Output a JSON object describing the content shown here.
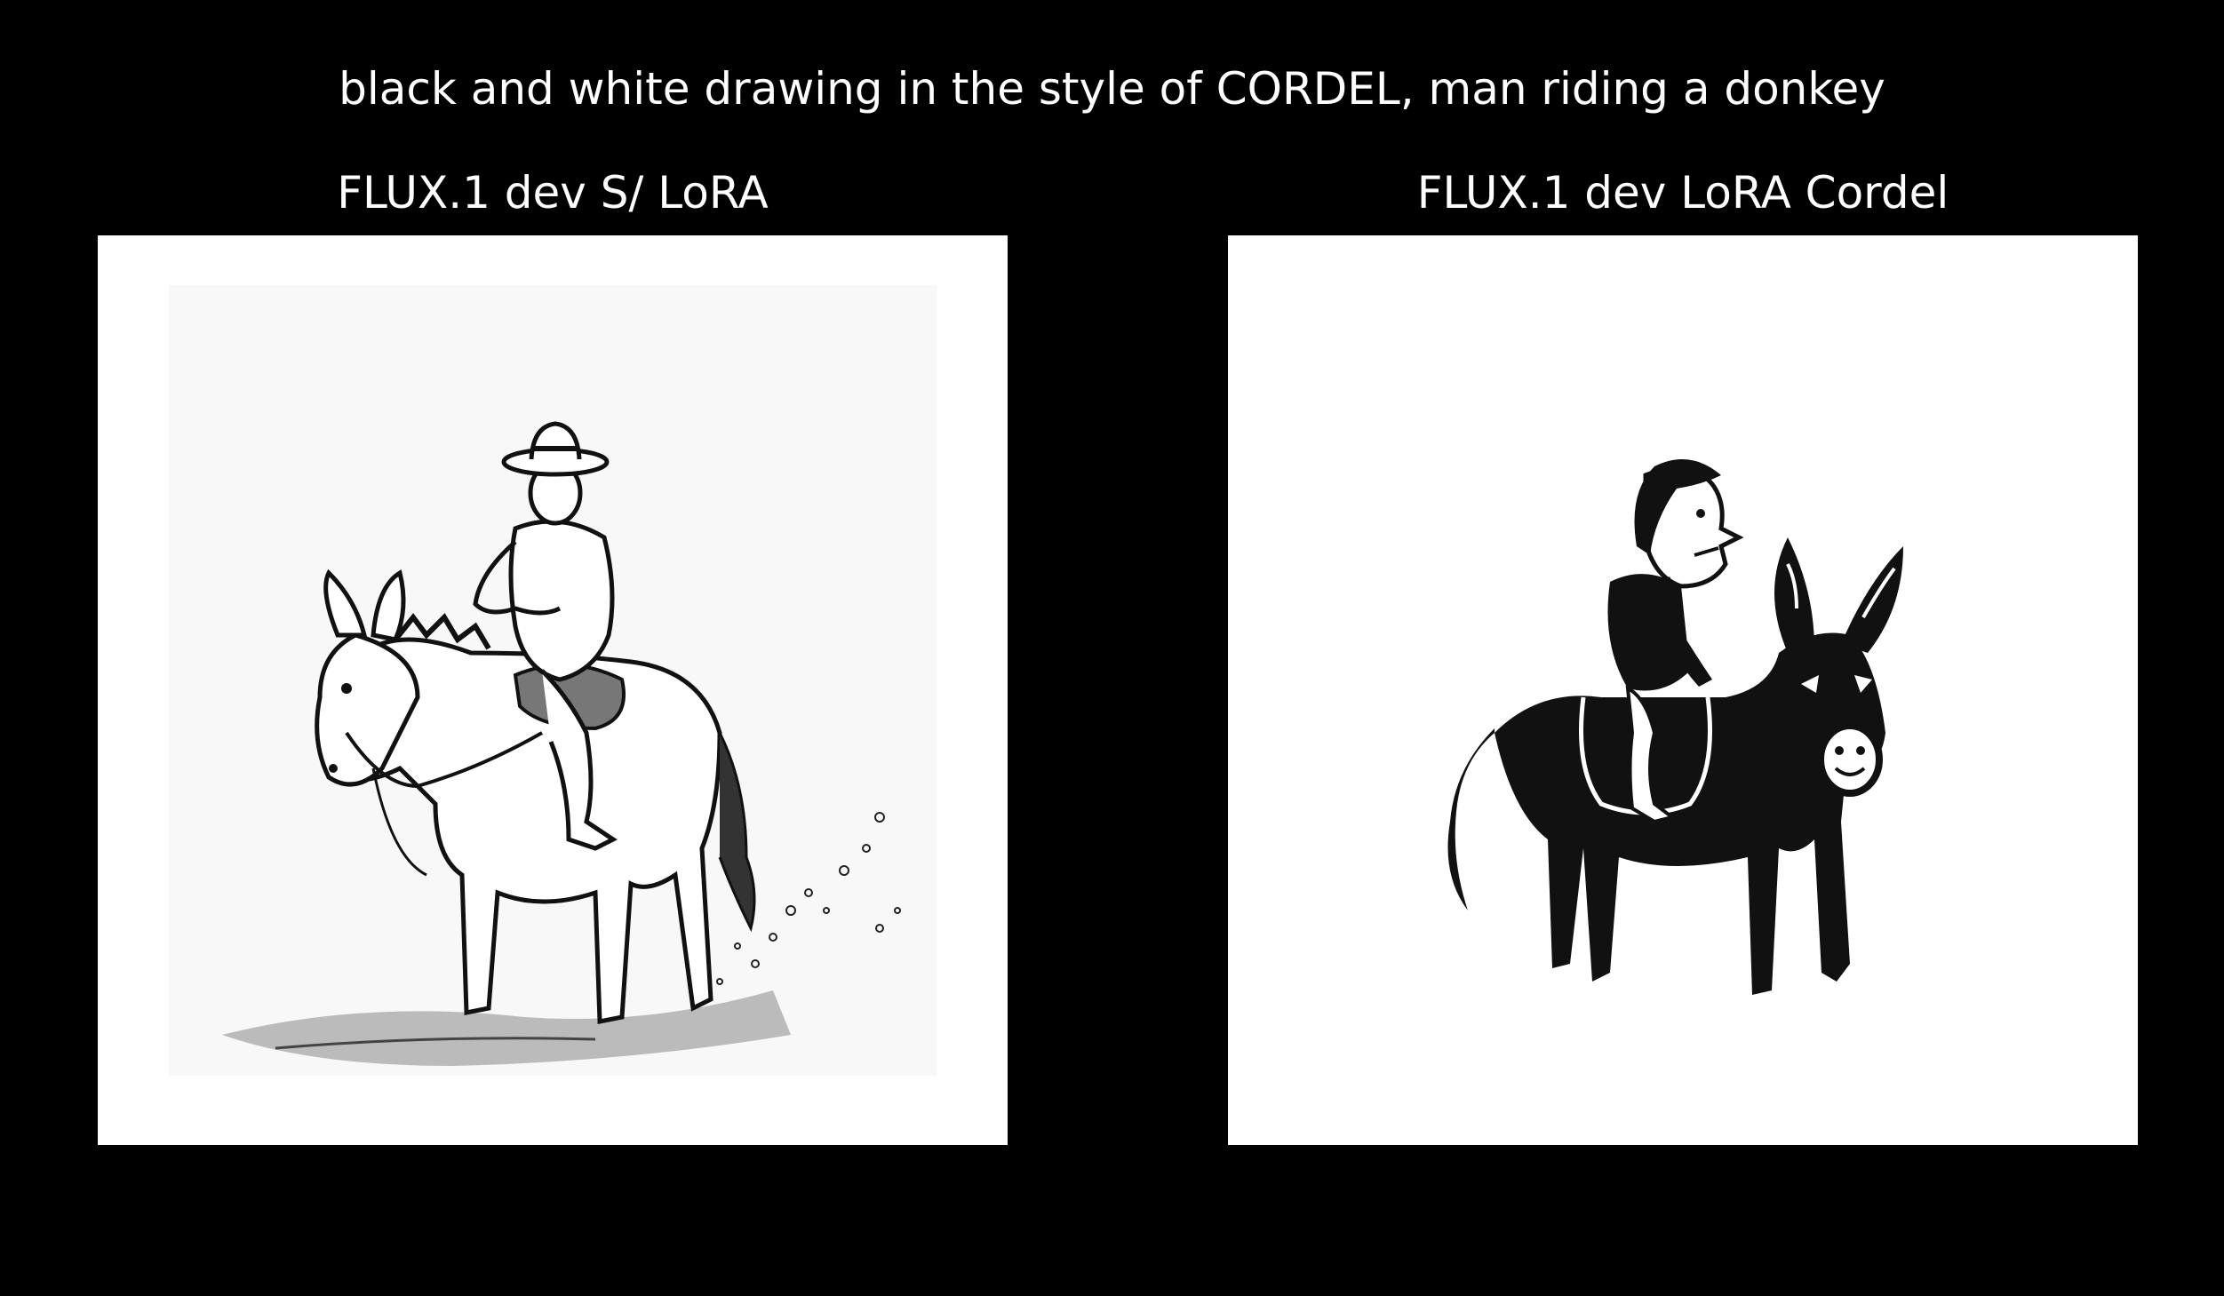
{
  "prompt": "black and white drawing in the style of CORDEL, man riding a donkey",
  "panels": [
    {
      "label": "FLUX.1 dev S/ LoRA",
      "illustration": "sketch-man-riding-donkey"
    },
    {
      "label": "FLUX.1 dev LoRA Cordel",
      "illustration": "cordel-woodcut-man-riding-donkey"
    }
  ],
  "colors": {
    "background": "#000000",
    "text": "#ffffff",
    "panel": "#ffffff",
    "ink": "#000000"
  }
}
